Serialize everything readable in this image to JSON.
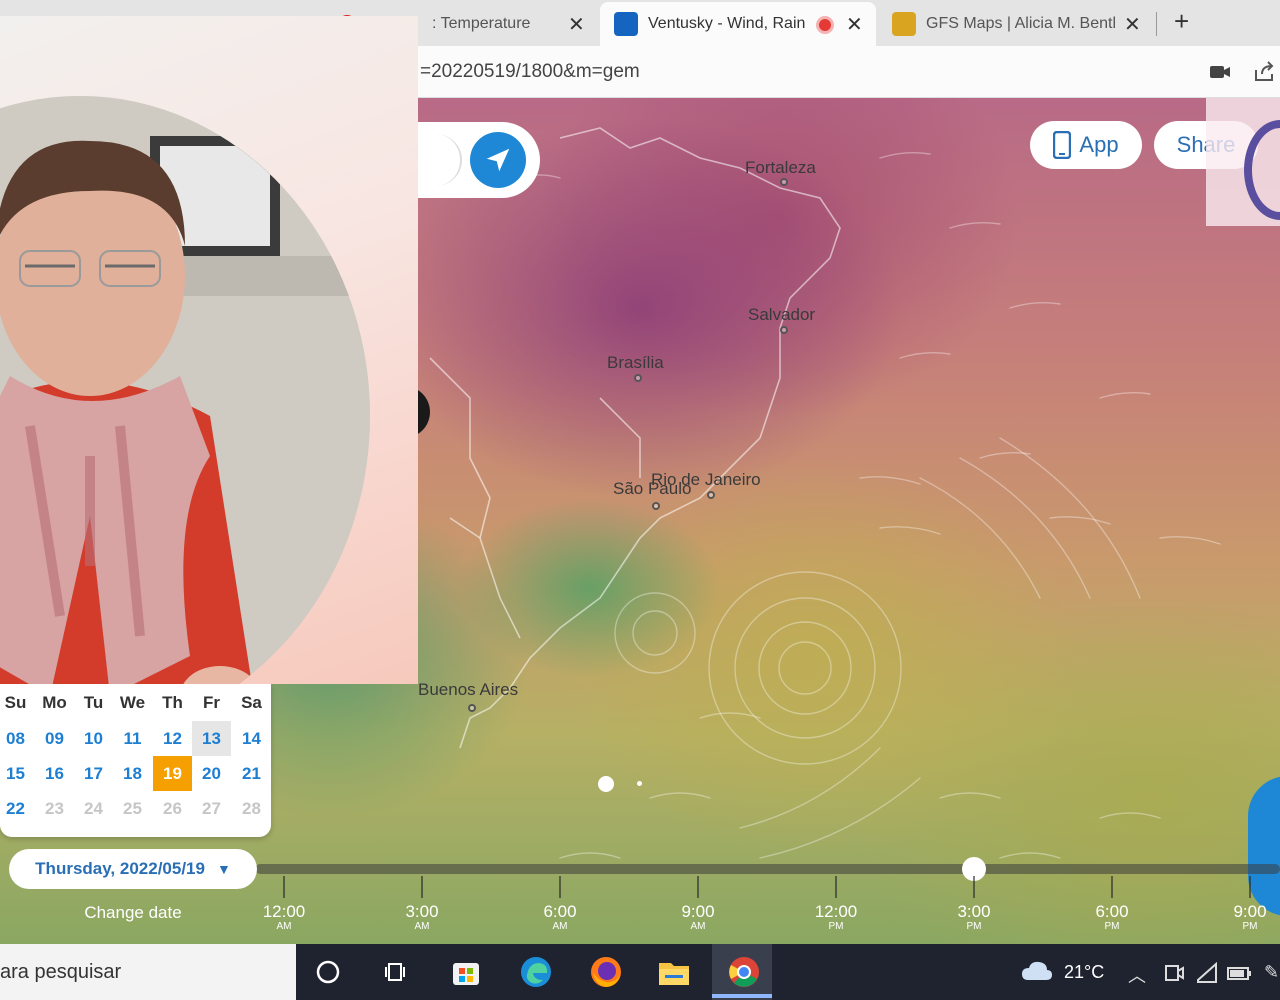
{
  "browser": {
    "tabs": [
      {
        "title": "",
        "closable": false
      },
      {
        "title": ": Temperature",
        "closable": true
      },
      {
        "title": "Ventusky - Wind, Rain",
        "closable": true,
        "active": true,
        "recording": true
      },
      {
        "title": "GFS Maps | Alicia M. Bentl",
        "closable": true
      }
    ],
    "new_tab_label": "+",
    "url": "=20220519/1800&m=gem"
  },
  "map": {
    "app_button": "App",
    "share_button": "Share",
    "cities": [
      {
        "name": "Fortaleza"
      },
      {
        "name": "Salvador"
      },
      {
        "name": "Brasília"
      },
      {
        "name": "São Paulo"
      },
      {
        "name": "Rio de Janeiro"
      },
      {
        "name": "Buenos Aires"
      }
    ]
  },
  "calendar": {
    "weekdays": [
      "Su",
      "Mo",
      "Tu",
      "We",
      "Th",
      "Fr",
      "Sa"
    ],
    "weeks": [
      [
        "08",
        "09",
        "10",
        "11",
        "12",
        "13",
        "14"
      ],
      [
        "15",
        "16",
        "17",
        "18",
        "19",
        "20",
        "21"
      ],
      [
        "22",
        "23",
        "24",
        "25",
        "26",
        "27",
        "28"
      ]
    ],
    "today": "13",
    "selected": "19",
    "available_until": "22"
  },
  "date_selector": {
    "label": "Thursday, 2022/05/19",
    "change_date": "Change date"
  },
  "timeline": {
    "ticks": [
      {
        "time": "12:00",
        "period": "AM"
      },
      {
        "time": "3:00",
        "period": "AM"
      },
      {
        "time": "6:00",
        "period": "AM"
      },
      {
        "time": "9:00",
        "period": "AM"
      },
      {
        "time": "12:00",
        "period": "PM"
      },
      {
        "time": "3:00",
        "period": "PM"
      },
      {
        "time": "6:00",
        "period": "PM"
      },
      {
        "time": "9:00",
        "period": "PM"
      }
    ],
    "selected_time": "6:00 PM"
  },
  "taskbar": {
    "search_placeholder": "ara pesquisar",
    "weather_temp": "21°C",
    "pinned": [
      "cortana-icon",
      "task-view-icon",
      "store-icon",
      "edge-icon",
      "firefox-icon",
      "file-explorer-icon",
      "chrome-icon"
    ]
  },
  "colors": {
    "accent_blue": "#1e88d6",
    "selected_day": "#f5a000",
    "link_blue": "#2a6fb5"
  }
}
